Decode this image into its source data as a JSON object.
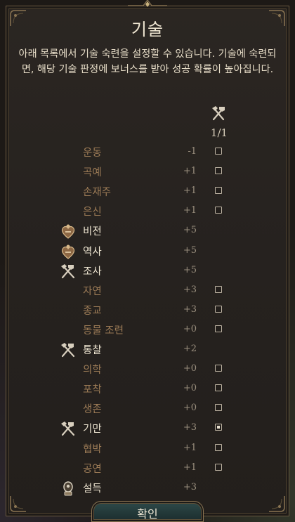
{
  "dialog": {
    "title": "기술",
    "description": "아래 목록에서 기술 숙련을 설정할 수 있습니다. 기술에 숙련되면, 해당 기술 판정에 보너스를 받아 성공 확률이 높아집니다.",
    "proficiency_column": {
      "icon": "crossed-hammers-icon",
      "count": "1/1"
    },
    "confirm_label": "확인"
  },
  "skills": [
    {
      "name": "운동",
      "modifier": "-1",
      "proficient": false,
      "selectable": true,
      "checked": false,
      "icon": null
    },
    {
      "name": "곡예",
      "modifier": "+1",
      "proficient": false,
      "selectable": true,
      "checked": false,
      "icon": null
    },
    {
      "name": "손재주",
      "modifier": "+1",
      "proficient": false,
      "selectable": true,
      "checked": false,
      "icon": null
    },
    {
      "name": "은신",
      "modifier": "+1",
      "proficient": false,
      "selectable": true,
      "checked": false,
      "icon": null
    },
    {
      "name": "비전",
      "modifier": "+5",
      "proficient": true,
      "selectable": false,
      "checked": false,
      "icon": "heart-emblem-icon"
    },
    {
      "name": "역사",
      "modifier": "+5",
      "proficient": true,
      "selectable": false,
      "checked": false,
      "icon": "heart-emblem-icon"
    },
    {
      "name": "조사",
      "modifier": "+5",
      "proficient": true,
      "selectable": false,
      "checked": false,
      "icon": "crossed-hammers-icon"
    },
    {
      "name": "자연",
      "modifier": "+3",
      "proficient": false,
      "selectable": true,
      "checked": false,
      "icon": null
    },
    {
      "name": "종교",
      "modifier": "+3",
      "proficient": false,
      "selectable": true,
      "checked": false,
      "icon": null
    },
    {
      "name": "동물 조련",
      "modifier": "+0",
      "proficient": false,
      "selectable": true,
      "checked": false,
      "icon": null
    },
    {
      "name": "통찰",
      "modifier": "+2",
      "proficient": true,
      "selectable": false,
      "checked": false,
      "icon": "crossed-hammers-icon"
    },
    {
      "name": "의학",
      "modifier": "+0",
      "proficient": false,
      "selectable": true,
      "checked": false,
      "icon": null
    },
    {
      "name": "포착",
      "modifier": "+0",
      "proficient": false,
      "selectable": true,
      "checked": false,
      "icon": null
    },
    {
      "name": "생존",
      "modifier": "+0",
      "proficient": false,
      "selectable": true,
      "checked": false,
      "icon": null
    },
    {
      "name": "기만",
      "modifier": "+3",
      "proficient": true,
      "selectable": true,
      "checked": true,
      "icon": "crossed-hammers-icon"
    },
    {
      "name": "협박",
      "modifier": "+1",
      "proficient": false,
      "selectable": true,
      "checked": false,
      "icon": null
    },
    {
      "name": "공연",
      "modifier": "+1",
      "proficient": false,
      "selectable": true,
      "checked": false,
      "icon": null
    },
    {
      "name": "설득",
      "modifier": "+3",
      "proficient": true,
      "selectable": false,
      "checked": false,
      "icon": "lock-medallion-icon"
    }
  ],
  "colors": {
    "proficient_text": "#efe6d2",
    "non_proficient_text": "#9c7b56",
    "modifier_text": "#9a8f7e",
    "panel_border": "#6b5a41",
    "confirm_button": "#2f4a4a"
  }
}
